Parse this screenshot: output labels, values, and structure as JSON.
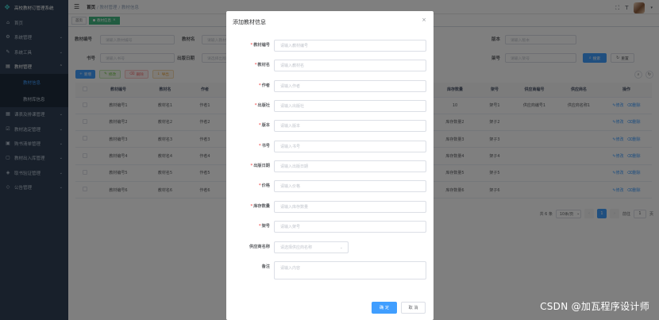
{
  "app": {
    "title": "高校教材订管理系统"
  },
  "sidebar": {
    "items": [
      {
        "label": "首页",
        "icon": "home-icon"
      },
      {
        "label": "系统管理",
        "icon": "gear-icon",
        "arrow": "chevron-down-icon"
      },
      {
        "label": "系统工具",
        "icon": "tool-icon",
        "arrow": "chevron-down-icon"
      },
      {
        "label": "教材管理",
        "icon": "book-icon",
        "arrow": "chevron-up-icon"
      },
      {
        "label": "课表及排课管理",
        "icon": "calendar-icon",
        "arrow": "chevron-down-icon"
      },
      {
        "label": "教材选定管理",
        "icon": "check-icon",
        "arrow": "chevron-down-icon"
      },
      {
        "label": "购书清单管理",
        "icon": "cart-icon",
        "arrow": "chevron-down-icon"
      },
      {
        "label": "教材出入库管理",
        "icon": "box-icon",
        "arrow": "chevron-down-icon"
      },
      {
        "label": "取书验证管理",
        "icon": "shield-icon",
        "arrow": "chevron-down-icon"
      },
      {
        "label": "公告管理",
        "icon": "bell-icon",
        "arrow": "chevron-down-icon"
      }
    ],
    "submenu": [
      {
        "label": "教材信息",
        "active": true
      },
      {
        "label": "教材库信息",
        "active": false
      }
    ]
  },
  "navbar": {
    "breadcrumb": [
      "首页",
      "教材管理",
      "教材信息"
    ]
  },
  "tags": [
    {
      "label": "首页",
      "active": false
    },
    {
      "label": "教材信息",
      "active": true,
      "close": "×"
    }
  ],
  "search": {
    "fields": [
      {
        "label": "教材编号",
        "placeholder": "请输入教材编号"
      },
      {
        "label": "教材名",
        "placeholder": "请输入教材名"
      },
      {
        "label": "版本",
        "placeholder": "请输入版本"
      },
      {
        "label": "书号",
        "placeholder": "请输入书号"
      },
      {
        "label": "出版日期",
        "placeholder": "请选择出版日期"
      },
      {
        "label": "架号",
        "placeholder": "请输入架号"
      }
    ],
    "search_label": "搜索",
    "reset_label": "重置"
  },
  "toolbar": {
    "add_label": "新增",
    "edit_label": "修改",
    "delete_label": "删除",
    "export_label": "导出"
  },
  "table": {
    "headers": [
      "教材编号",
      "教材名",
      "作者",
      "库存数量",
      "架号",
      "供应商编号",
      "供应商名",
      "操作"
    ],
    "rows": [
      [
        "教材编号1",
        "教材名1",
        "作者1",
        "10",
        "架号1",
        "供应商编号1",
        "供应商名称1"
      ],
      [
        "教材编号2",
        "教材名2",
        "作者2",
        "库存数量2",
        "架子2",
        "",
        ""
      ],
      [
        "教材编号3",
        "教材名3",
        "作者3",
        "库存数量3",
        "架子3",
        "",
        ""
      ],
      [
        "教材编号4",
        "教材名4",
        "作者4",
        "库存数量4",
        "架子4",
        "",
        ""
      ],
      [
        "教材编号5",
        "教材名5",
        "作者5",
        "库存数量5",
        "架子5",
        "",
        ""
      ],
      [
        "教材编号6",
        "教材名6",
        "作者6",
        "库存数量6",
        "架子6",
        "",
        ""
      ]
    ],
    "edit_label": "修改",
    "delete_label": "删除"
  },
  "pager": {
    "total_label": "共 6 条",
    "page_size": "10条/页",
    "current_page": "1",
    "goto_label": "前往",
    "goto_value": "1",
    "page_unit": "页"
  },
  "dialog": {
    "title": "添加教材信息",
    "fields": [
      {
        "label": "教材编号",
        "placeholder": "请输入教材编号",
        "required": true
      },
      {
        "label": "教材名",
        "placeholder": "请输入教材名",
        "required": true
      },
      {
        "label": "作者",
        "placeholder": "请输入作者",
        "required": true
      },
      {
        "label": "出版社",
        "placeholder": "请输入出版社",
        "required": true
      },
      {
        "label": "版本",
        "placeholder": "请输入版本",
        "required": true
      },
      {
        "label": "书号",
        "placeholder": "请输入书号",
        "required": true
      },
      {
        "label": "出版日期",
        "placeholder": "请输入出版日期",
        "required": true
      },
      {
        "label": "价格",
        "placeholder": "请输入价格",
        "required": true
      },
      {
        "label": "库存数量",
        "placeholder": "请输入库存数量",
        "required": true
      },
      {
        "label": "架号",
        "placeholder": "请输入架号",
        "required": true
      },
      {
        "label": "供应商名称",
        "placeholder": "请选择供应商名称",
        "required": false
      },
      {
        "label": "备注",
        "placeholder": "请输入内容",
        "required": false
      }
    ],
    "ok_label": "确 定",
    "cancel_label": "取 消"
  },
  "watermark": "CSDN @加瓦程序设计师",
  "colors": {
    "primary": "#409eff",
    "sidebar": "#304156",
    "danger": "#f56c6c",
    "success": "#67c23a",
    "warning": "#e6a23c",
    "tag_active": "#42b983"
  }
}
